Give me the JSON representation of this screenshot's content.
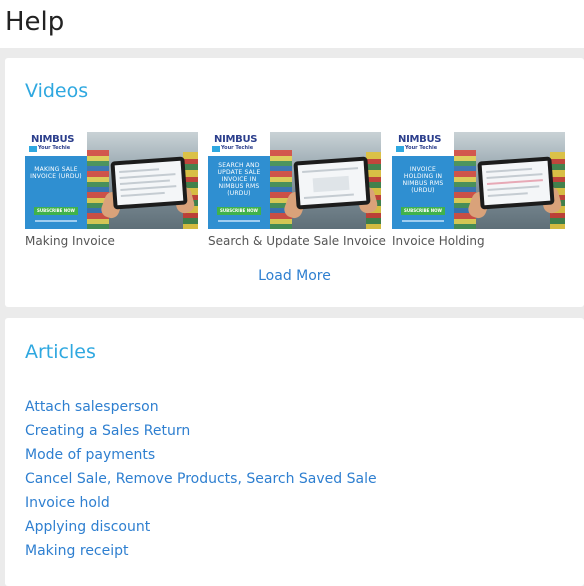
{
  "page": {
    "title": "Help"
  },
  "videos": {
    "heading": "Videos",
    "load_more_label": "Load More",
    "items": [
      {
        "caption": "Making Invoice",
        "thumb_text": "MAKING SALE INVOICE (URDU)"
      },
      {
        "caption": "Search & Update Sale Invoice",
        "thumb_text": "SEARCH AND UPDATE SALE INVOICE IN NIMBUS RMS (URDU)"
      },
      {
        "caption": "Invoice Holding",
        "thumb_text": "INVOICE HOLDING IN NIMBUS RMS (URDU)"
      }
    ],
    "thumb_brand": "NIMBUS",
    "thumb_sub": "Your Techie",
    "thumb_button": "SUBSCRIBE NOW"
  },
  "articles": {
    "heading": "Articles",
    "items": [
      "Attach salesperson",
      "Creating a Sales Return",
      "Mode of payments",
      "Cancel Sale, Remove Products, Search Saved Sale",
      "Invoice hold",
      "Applying discount",
      "Making receipt"
    ]
  },
  "colors": {
    "heading": "#2fa8e0",
    "link": "#2e7fd0",
    "background": "#ebebeb"
  }
}
